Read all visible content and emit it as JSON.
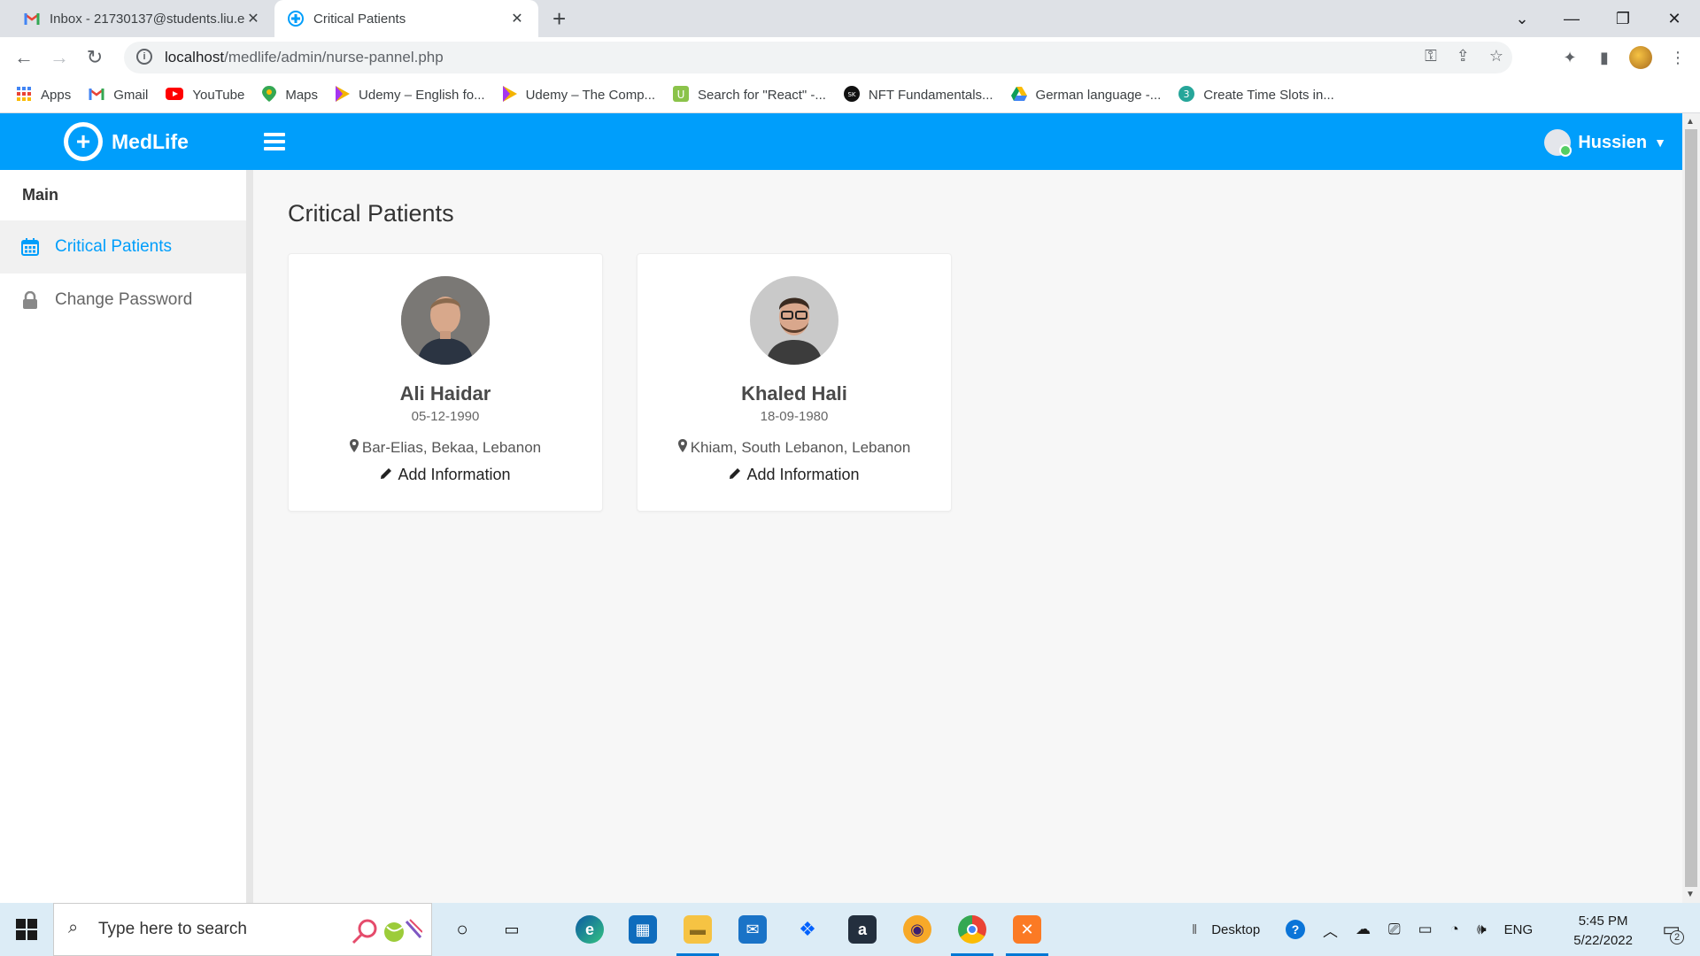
{
  "browser": {
    "tabs": [
      {
        "title": "Inbox - 21730137@students.liu.e",
        "icon": "gmail-icon"
      },
      {
        "title": "Critical Patients",
        "icon": "medlife-icon"
      }
    ],
    "url_host": "localhost",
    "url_path": "/medlife/admin/nurse-pannel.php",
    "bookmarks": [
      {
        "label": "Apps",
        "icon": "apps-grid-icon",
        "color": "#4285f4"
      },
      {
        "label": "Gmail",
        "icon": "gmail-icon",
        "color": "#ea4335"
      },
      {
        "label": "YouTube",
        "icon": "youtube-icon",
        "color": "#ff0000"
      },
      {
        "label": "Maps",
        "icon": "maps-icon",
        "color": "#34a853"
      },
      {
        "label": "Udemy – English fo...",
        "icon": "udemy-icon",
        "color": "#f4b400"
      },
      {
        "label": "Udemy – The Comp...",
        "icon": "udemy-icon",
        "color": "#f4b400"
      },
      {
        "label": "Search for \"React\" -...",
        "icon": "search-site-icon",
        "color": "#8bc34a"
      },
      {
        "label": "NFT Fundamentals...",
        "icon": "nft-icon",
        "color": "#111111"
      },
      {
        "label": "German language -...",
        "icon": "drive-icon",
        "color": "#0f9d58"
      },
      {
        "label": "Create Time Slots in...",
        "icon": "slots-icon",
        "color": "#26a69a"
      }
    ]
  },
  "app": {
    "brand": "MedLife",
    "brand_color": "#009efb",
    "user_name": "Hussien",
    "sidebar": {
      "section_title": "Main",
      "items": [
        {
          "label": "Critical Patients",
          "icon": "calendar-icon",
          "active": true
        },
        {
          "label": "Change Password",
          "icon": "lock-icon",
          "active": false
        }
      ]
    },
    "page_title": "Critical Patients",
    "patients": [
      {
        "name": "Ali Haidar",
        "dob": "05-12-1990",
        "location": "Bar-Elias, Bekaa, Lebanon",
        "action": "Add Information"
      },
      {
        "name": "Khaled Hali",
        "dob": "18-09-1980",
        "location": "Khiam, South Lebanon, Lebanon",
        "action": "Add Information"
      }
    ]
  },
  "taskbar": {
    "search_placeholder": "Type here to search",
    "desktop_label": "Desktop",
    "language": "ENG",
    "time": "5:45 PM",
    "date": "5/22/2022",
    "notification_count": "2"
  }
}
